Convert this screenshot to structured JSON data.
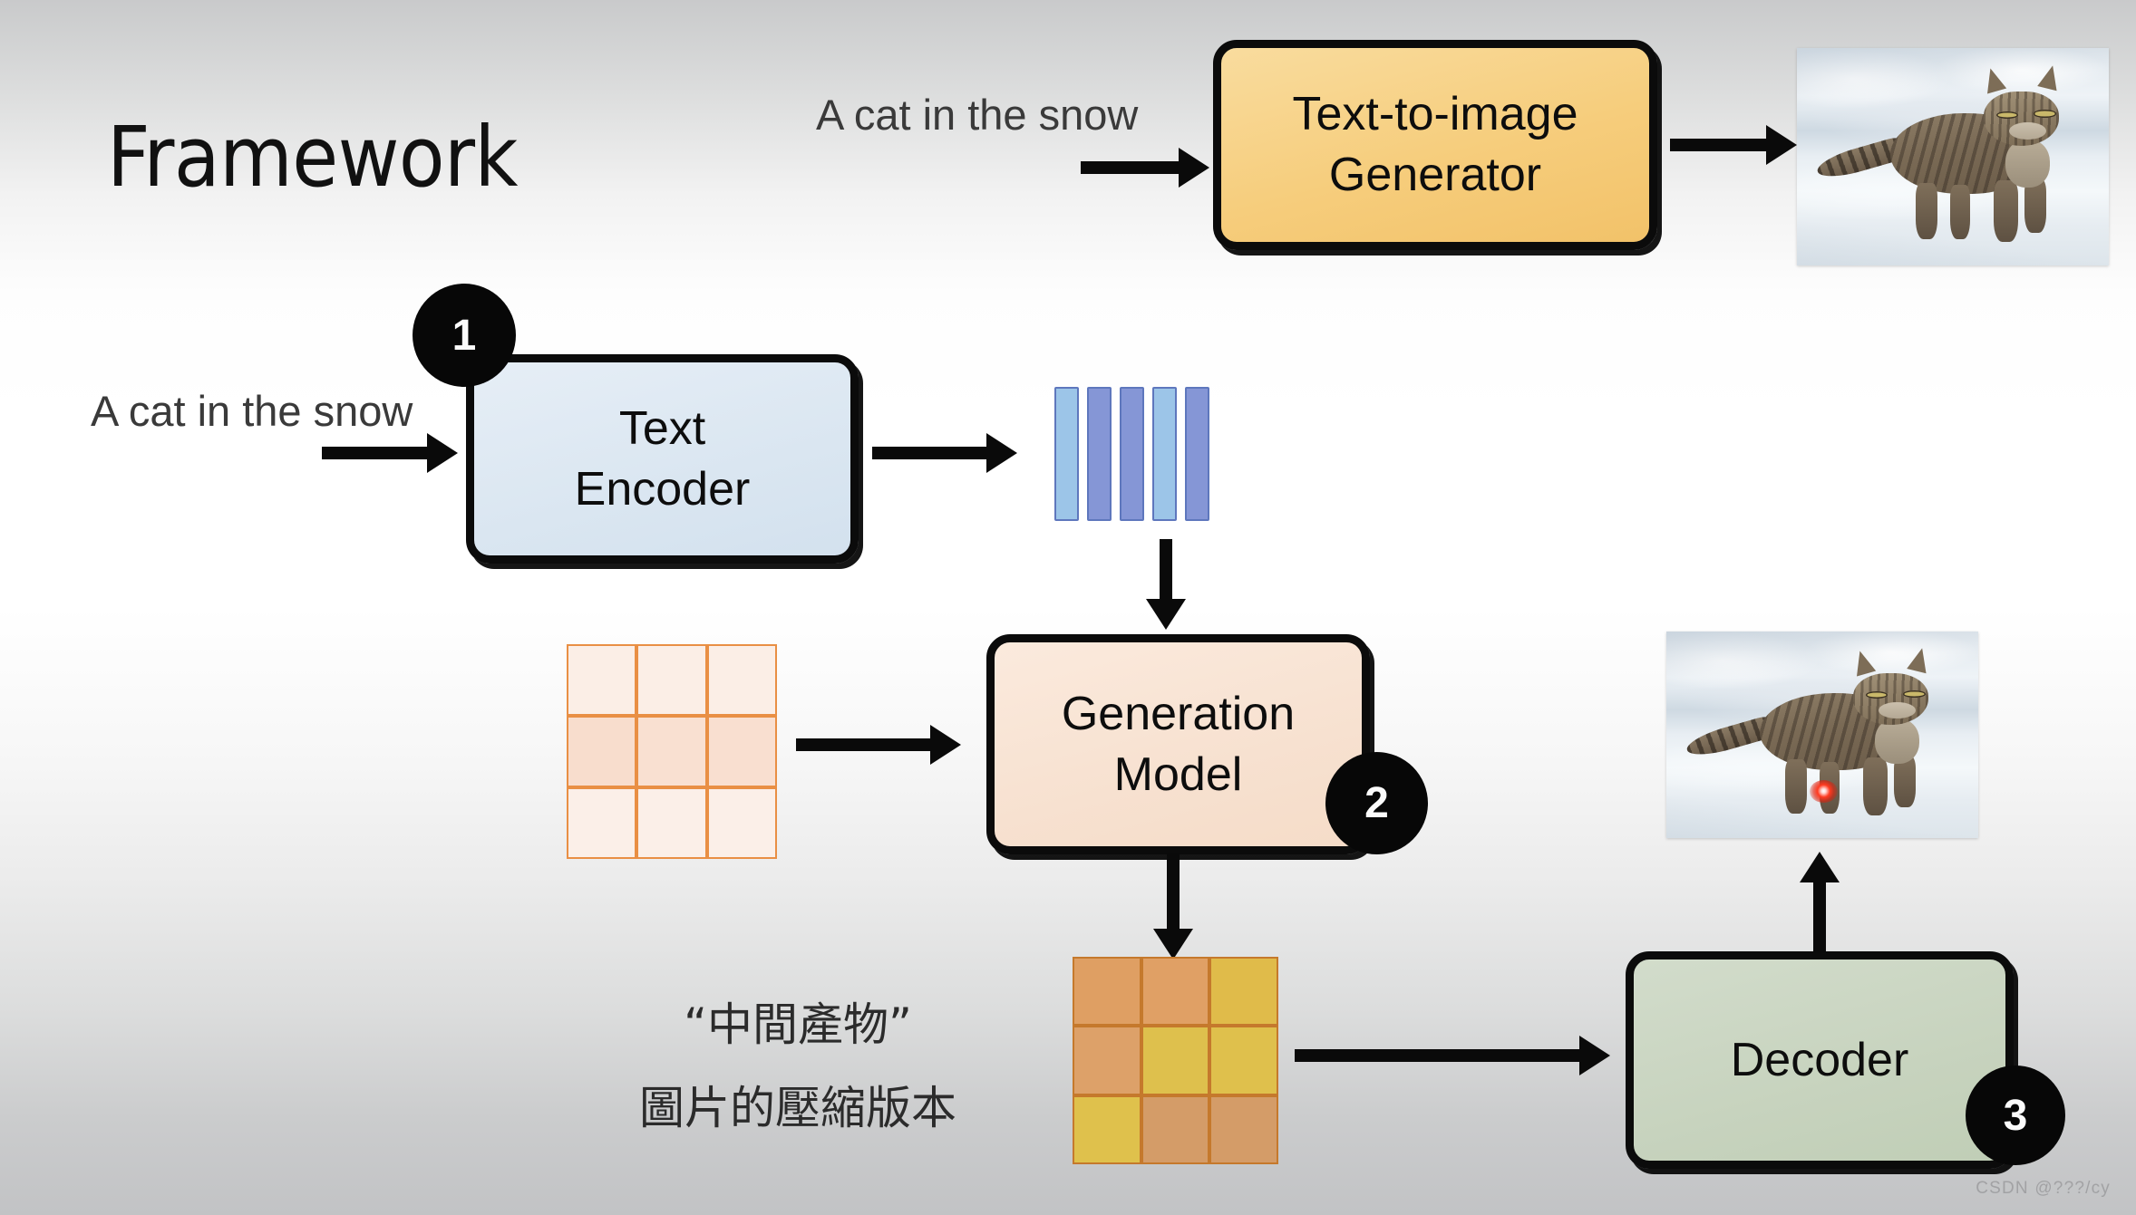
{
  "slide": {
    "title": "Framework",
    "watermark": "CSDN @???/cy",
    "background_top_color": "#c9cacb",
    "background_mid_color": "#ffffff",
    "background_bottom_color": "#c2c3c5"
  },
  "top_row": {
    "prompt": "A cat in\nthe snow",
    "generator_box": {
      "label": "Text-to-image\nGenerator",
      "fill_color": "#f6cd7c",
      "border_color": "#0b0b0b"
    },
    "output_photo": {
      "alt": "tabby cat standing in snow"
    }
  },
  "pipeline": {
    "prompt": "A cat in\nthe snow",
    "steps": [
      {
        "number": "1",
        "box_label": "Text\nEncoder",
        "fill_color": "#dae6f1"
      },
      {
        "number": "2",
        "box_label": "Generation\nModel",
        "fill_color": "#f7e1d0"
      },
      {
        "number": "3",
        "box_label": "Decoder",
        "fill_color": "#c7d3be"
      }
    ],
    "token_bars": {
      "count": 5,
      "colors": [
        "#9cc5e8",
        "#8596d6",
        "#8596d6",
        "#9cc5e8",
        "#8596d6"
      ],
      "border_color": "#5e77bd"
    },
    "noise_grid": {
      "rows": 3,
      "cols": 3,
      "border_color": "#e98f44",
      "cells": [
        [
          "#fbeee6",
          "#fbeee6",
          "#fbeee6"
        ],
        [
          "#f8ddcd",
          "#f9e0d1",
          "#f9dfd0"
        ],
        [
          "#fbefe8",
          "#fbefe8",
          "#fbefe8"
        ]
      ]
    },
    "latent_grid": {
      "rows": 3,
      "cols": 3,
      "border_color": "#c5792c",
      "cells": [
        [
          "#df9f63",
          "#e0a065",
          "#e0bb4a"
        ],
        [
          "#dda169",
          "#dec04d",
          "#dfc04c"
        ],
        [
          "#dfc14c",
          "#d49c68",
          "#d49c68"
        ]
      ]
    },
    "latent_caption_line1": "“中間產物”",
    "latent_caption_line2": "圖片的壓縮版本",
    "decoded_photo": {
      "alt": "tabby cat standing in snow with red laser dot near paw",
      "laser_color": "#ff3a20"
    }
  }
}
